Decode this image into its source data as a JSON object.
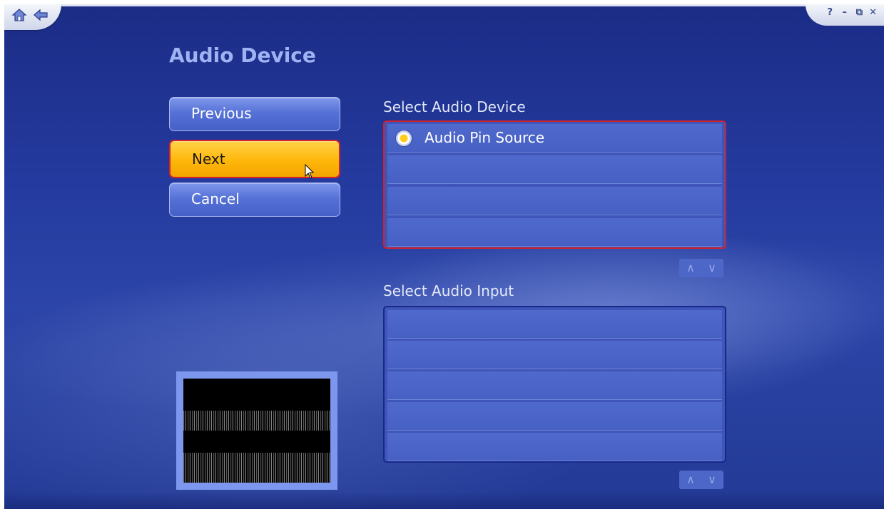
{
  "header": {
    "title": "Audio Device"
  },
  "buttons": {
    "previous": "Previous",
    "next": "Next",
    "cancel": "Cancel"
  },
  "audio_device": {
    "label": "Select Audio Device",
    "options": [
      "Audio Pin Source"
    ],
    "selected": "Audio Pin Source"
  },
  "audio_input": {
    "label": "Select Audio Input",
    "options": []
  },
  "icons": {
    "home": "home-icon",
    "back": "back-arrow-icon",
    "help": "help-icon",
    "minimize": "minimize-icon",
    "restore": "restore-icon",
    "close": "close-icon",
    "scroll_up": "chevron-up-icon",
    "scroll_down": "chevron-down-icon",
    "radio": "radio-selected-icon"
  },
  "glyphs": {
    "help": "?",
    "minimize": "–",
    "restore": "⧉",
    "close": "✕",
    "up": "∧",
    "down": "∨"
  },
  "colors": {
    "background": "#2a43a6",
    "title": "#9fb3f2",
    "next_button": "#ffb70a",
    "highlight_border": "#d2202e",
    "list_row": "#4d67c8"
  }
}
